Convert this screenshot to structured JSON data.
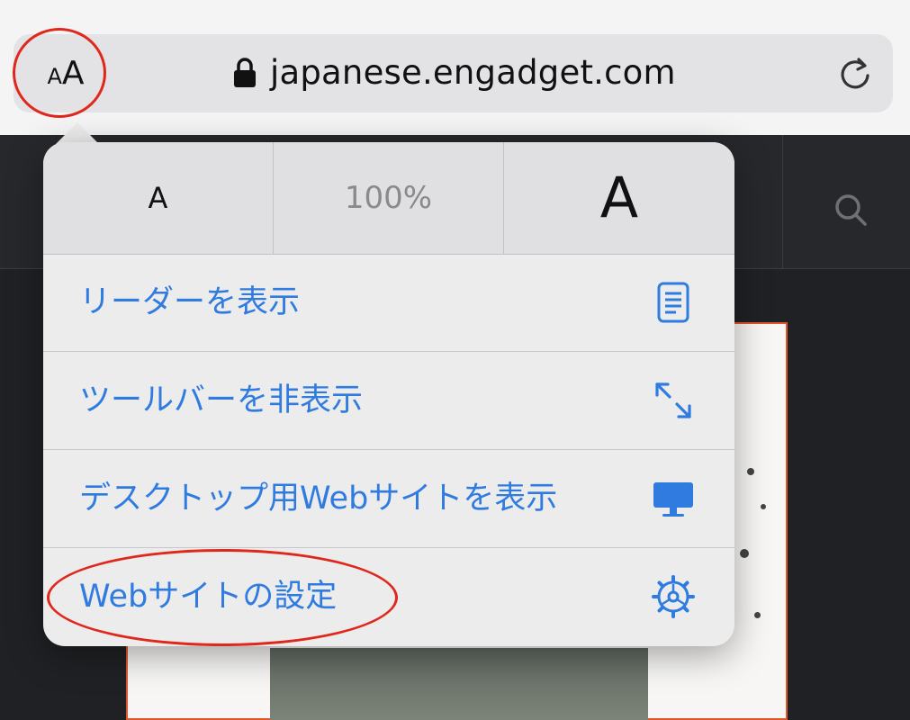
{
  "address_bar": {
    "text_size_button_label_small": "A",
    "text_size_button_label_big": "A",
    "url": "japanese.engadget.com"
  },
  "text_size": {
    "decrease_label": "A",
    "zoom_level": "100%",
    "increase_label": "A"
  },
  "menu": {
    "items": [
      {
        "label": "リーダーを表示",
        "icon": "reader-icon"
      },
      {
        "label": "ツールバーを非表示",
        "icon": "expand-arrows-icon"
      },
      {
        "label": "デスクトップ用Webサイトを表示",
        "icon": "desktop-icon"
      },
      {
        "label": "Webサイトの設定",
        "icon": "gear-icon"
      }
    ]
  },
  "colors": {
    "accent": "#2f7be0",
    "annotation": "#e0271c"
  }
}
